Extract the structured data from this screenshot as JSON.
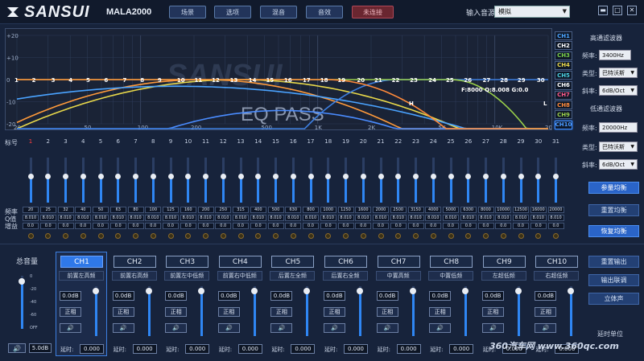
{
  "header": {
    "brand": "SANSUI",
    "model": "MALA2000",
    "buttons": [
      "场景",
      "选项",
      "混音",
      "音效",
      "未连接"
    ],
    "input_label": "输入音源",
    "input_value": "模拟"
  },
  "graph": {
    "y_ticks": [
      "+20",
      "+10",
      "0",
      "-10",
      "-20"
    ],
    "x_ticks": [
      "20",
      "50",
      "100",
      "200",
      "500",
      "1K",
      "2K",
      "5K",
      "10K",
      "20K"
    ],
    "band_numbers": [
      "1",
      "2",
      "3",
      "4",
      "5",
      "6",
      "7",
      "8",
      "9",
      "10",
      "11",
      "12",
      "13",
      "14",
      "15",
      "16",
      "17",
      "18",
      "19",
      "20",
      "21",
      "22",
      "23",
      "24",
      "25",
      "26",
      "27",
      "28",
      "29",
      "30",
      "31"
    ],
    "watermark": "SANSUI",
    "overlay": "EQ PASS",
    "info": "F:8000 Q:8.008 G:0.0",
    "mark_h": "H",
    "mark_l": "L",
    "legend": [
      {
        "n": "CH1",
        "c": "#4aa3ff"
      },
      {
        "n": "CH2",
        "c": "#ffffff"
      },
      {
        "n": "CH3",
        "c": "#7ad04a"
      },
      {
        "n": "CH4",
        "c": "#e8d84a"
      },
      {
        "n": "CH5",
        "c": "#4ad0e0"
      },
      {
        "n": "CH6",
        "c": "#ffffff"
      },
      {
        "n": "CH7",
        "c": "#ff5a8a"
      },
      {
        "n": "CH8",
        "c": "#ff8a3a"
      },
      {
        "n": "CH9",
        "c": "#9ad04a"
      },
      {
        "n": "CH10",
        "c": "#4a9aff"
      }
    ]
  },
  "hpf": {
    "title": "高通滤波器",
    "freq_label": "频率:",
    "freq": "3400Hz",
    "type_label": "类型:",
    "type": "巴特沃斯",
    "slope_label": "斜率:",
    "slope": "6dB/Oct"
  },
  "lpf": {
    "title": "低通滤波器",
    "freq_label": "频率:",
    "freq": "20000Hz",
    "type_label": "类型:",
    "type": "巴特沃斯",
    "slope_label": "斜率:",
    "slope": "6dB/Oct"
  },
  "eq_buttons": [
    "参量均衡",
    "重置均衡",
    "恢复均衡"
  ],
  "output_buttons": [
    "重置输出",
    "输出联调",
    "立体声"
  ],
  "delay_unit_label": "延时单位",
  "row_labels": {
    "band": "标号",
    "freq": "频率",
    "q": "Q值",
    "gain": "增益"
  },
  "bands": [
    {
      "n": "1",
      "f": "20",
      "q": "8.010",
      "g": "0.0",
      "lvl": 0.58
    },
    {
      "n": "2",
      "f": "25",
      "q": "8.010",
      "g": "0.0",
      "lvl": 0.58
    },
    {
      "n": "3",
      "f": "32",
      "q": "8.010",
      "g": "0.0",
      "lvl": 0.58
    },
    {
      "n": "4",
      "f": "40",
      "q": "8.010",
      "g": "0.0",
      "lvl": 0.58
    },
    {
      "n": "5",
      "f": "50",
      "q": "8.010",
      "g": "0.0",
      "lvl": 0.58
    },
    {
      "n": "6",
      "f": "63",
      "q": "8.010",
      "g": "0.0",
      "lvl": 0.58
    },
    {
      "n": "7",
      "f": "80",
      "q": "8.010",
      "g": "0.0",
      "lvl": 0.58
    },
    {
      "n": "8",
      "f": "100",
      "q": "8.010",
      "g": "0.0",
      "lvl": 0.58
    },
    {
      "n": "9",
      "f": "125",
      "q": "8.010",
      "g": "0.0",
      "lvl": 0.58
    },
    {
      "n": "10",
      "f": "160",
      "q": "8.010",
      "g": "0.0",
      "lvl": 0.58
    },
    {
      "n": "11",
      "f": "200",
      "q": "8.010",
      "g": "0.0",
      "lvl": 0.58
    },
    {
      "n": "12",
      "f": "250",
      "q": "8.010",
      "g": "0.0",
      "lvl": 0.58
    },
    {
      "n": "13",
      "f": "315",
      "q": "8.010",
      "g": "0.0",
      "lvl": 0.58
    },
    {
      "n": "14",
      "f": "400",
      "q": "8.010",
      "g": "0.0",
      "lvl": 0.58
    },
    {
      "n": "15",
      "f": "500",
      "q": "8.010",
      "g": "0.0",
      "lvl": 0.58
    },
    {
      "n": "16",
      "f": "630",
      "q": "8.010",
      "g": "0.0",
      "lvl": 0.58
    },
    {
      "n": "17",
      "f": "800",
      "q": "8.010",
      "g": "0.0",
      "lvl": 0.58
    },
    {
      "n": "18",
      "f": "1000",
      "q": "8.010",
      "g": "0.0",
      "lvl": 0.58
    },
    {
      "n": "19",
      "f": "1250",
      "q": "8.010",
      "g": "0.0",
      "lvl": 0.58
    },
    {
      "n": "20",
      "f": "1600",
      "q": "8.010",
      "g": "0.0",
      "lvl": 0.58
    },
    {
      "n": "21",
      "f": "2000",
      "q": "8.010",
      "g": "0.0",
      "lvl": 0.58
    },
    {
      "n": "22",
      "f": "2500",
      "q": "8.010",
      "g": "0.0",
      "lvl": 0.58
    },
    {
      "n": "23",
      "f": "3150",
      "q": "8.010",
      "g": "0.0",
      "lvl": 0.58
    },
    {
      "n": "24",
      "f": "4000",
      "q": "8.010",
      "g": "0.0",
      "lvl": 0.58
    },
    {
      "n": "25",
      "f": "5000",
      "q": "8.010",
      "g": "0.0",
      "lvl": 0.58
    },
    {
      "n": "26",
      "f": "6300",
      "q": "8.010",
      "g": "0.0",
      "lvl": 0.58
    },
    {
      "n": "27",
      "f": "8000",
      "q": "8.010",
      "g": "0.0",
      "lvl": 0.58
    },
    {
      "n": "28",
      "f": "10000",
      "q": "8.010",
      "g": "0.0",
      "lvl": 0.58
    },
    {
      "n": "29",
      "f": "12500",
      "q": "8.010",
      "g": "0.0",
      "lvl": 0.58
    },
    {
      "n": "30",
      "f": "16000",
      "q": "8.010",
      "g": "0.0",
      "lvl": 0.58
    },
    {
      "n": "31",
      "f": "20000",
      "q": "8.010",
      "g": "0.0",
      "lvl": 0.58
    }
  ],
  "master": {
    "label": "总音量",
    "scale": [
      "0",
      "-20",
      "-40",
      "-60",
      "OFF"
    ],
    "value": "5.0dB",
    "level": 0.9
  },
  "channels": [
    {
      "name": "CH1",
      "pos": "前置左高频",
      "db": "0.0dB",
      "phase": "正相",
      "delay_label": "延时:",
      "delay": "0.000",
      "lvl": 0.9
    },
    {
      "name": "CH2",
      "pos": "前置右高频",
      "db": "0.0dB",
      "phase": "正相",
      "delay_label": "延时:",
      "delay": "0.000",
      "lvl": 0.9
    },
    {
      "name": "CH3",
      "pos": "前置左中低频",
      "db": "0.0dB",
      "phase": "正相",
      "delay_label": "延时:",
      "delay": "0.000",
      "lvl": 0.9
    },
    {
      "name": "CH4",
      "pos": "前置右中低频",
      "db": "0.0dB",
      "phase": "正相",
      "delay_label": "延时:",
      "delay": "0.000",
      "lvl": 0.9
    },
    {
      "name": "CH5",
      "pos": "后置左全频",
      "db": "0.0dB",
      "phase": "正相",
      "delay_label": "延时:",
      "delay": "0.000",
      "lvl": 0.9
    },
    {
      "name": "CH6",
      "pos": "后置右全频",
      "db": "0.0dB",
      "phase": "正相",
      "delay_label": "延时:",
      "delay": "0.000",
      "lvl": 0.9
    },
    {
      "name": "CH7",
      "pos": "中置高频",
      "db": "0.0dB",
      "phase": "正相",
      "delay_label": "延时:",
      "delay": "0.000",
      "lvl": 0.9
    },
    {
      "name": "CH8",
      "pos": "中置低频",
      "db": "0.0dB",
      "phase": "正相",
      "delay_label": "延时:",
      "delay": "0.000",
      "lvl": 0.9
    },
    {
      "name": "CH9",
      "pos": "左超低频",
      "db": "0.0dB",
      "phase": "正相",
      "delay_label": "延时:",
      "delay": "0.000",
      "lvl": 0.9
    },
    {
      "name": "CH10",
      "pos": "右超低频",
      "db": "0.0dB",
      "phase": "正相",
      "delay_label": "延时:",
      "delay": "0.000",
      "lvl": 0.9
    }
  ],
  "site_watermark": "360汽车网 www.360qc.com"
}
